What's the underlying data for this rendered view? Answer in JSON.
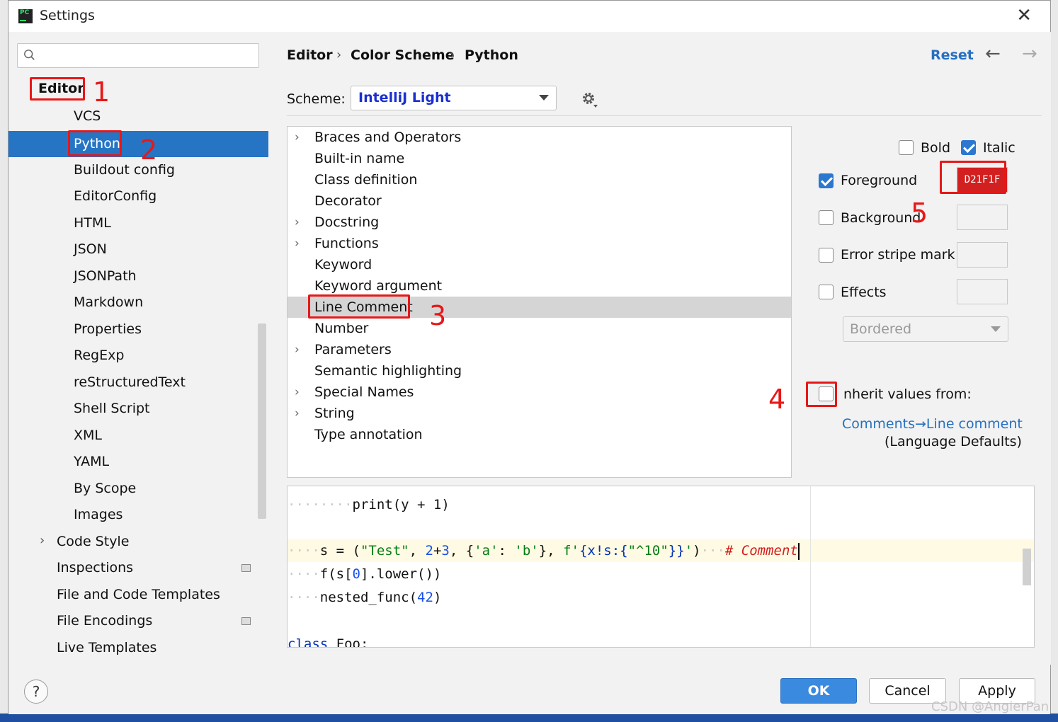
{
  "window": {
    "title": "Settings"
  },
  "sidebar": {
    "search_placeholder": "",
    "items": [
      {
        "label": "Editor"
      },
      {
        "label": "VCS"
      },
      {
        "label": "Python"
      },
      {
        "label": "Buildout config"
      },
      {
        "label": "EditorConfig"
      },
      {
        "label": "HTML"
      },
      {
        "label": "JSON"
      },
      {
        "label": "JSONPath"
      },
      {
        "label": "Markdown"
      },
      {
        "label": "Properties"
      },
      {
        "label": "RegExp"
      },
      {
        "label": "reStructuredText"
      },
      {
        "label": "Shell Script"
      },
      {
        "label": "XML"
      },
      {
        "label": "YAML"
      },
      {
        "label": "By Scope"
      },
      {
        "label": "Images"
      },
      {
        "label": "Code Style"
      },
      {
        "label": "Inspections"
      },
      {
        "label": "File and Code Templates"
      },
      {
        "label": "File Encodings"
      },
      {
        "label": "Live Templates"
      }
    ]
  },
  "breadcrumb": {
    "items": [
      "Editor",
      "Color Scheme",
      "Python"
    ]
  },
  "header": {
    "reset": "Reset"
  },
  "scheme": {
    "label": "Scheme:",
    "value": "IntelliJ Light"
  },
  "attributes": {
    "items": [
      {
        "label": "Braces and Operators"
      },
      {
        "label": "Built-in name"
      },
      {
        "label": "Class definition"
      },
      {
        "label": "Decorator"
      },
      {
        "label": "Docstring"
      },
      {
        "label": "Functions"
      },
      {
        "label": "Keyword"
      },
      {
        "label": "Keyword argument"
      },
      {
        "label": "Line Comment"
      },
      {
        "label": "Number"
      },
      {
        "label": "Parameters"
      },
      {
        "label": "Semantic highlighting"
      },
      {
        "label": "Special Names"
      },
      {
        "label": "String"
      },
      {
        "label": "Type annotation"
      }
    ]
  },
  "properties": {
    "bold": "Bold",
    "italic": "Italic",
    "foreground": "Foreground",
    "foreground_color": "D21F1F",
    "background": "Background",
    "error_stripe": "Error stripe mark",
    "effects": "Effects",
    "effects_type": "Bordered",
    "inherit": "nherit values from:",
    "inherit_link": "Comments→Line comment",
    "inherit_note": "(Language Defaults)"
  },
  "annotations": [
    "1",
    "2",
    "3",
    "4",
    "5"
  ],
  "preview": {
    "line1_code": "print(y + 1)",
    "line2_var": "s = (",
    "line2_str1": "\"Test\"",
    "line2_n1": "2",
    "line2_plus": "+",
    "line2_n2": "3",
    "line2_dict_open": ", {",
    "line2_str2": "'a'",
    "line2_colon": ": ",
    "line2_str3": "'b'",
    "line2_dict_close": "}, ",
    "line2_fstr1": "f'",
    "line2_fexpr": "{x!s:{",
    "line2_fstr2": "\"^10\"",
    "line2_fclose": "}}",
    "line2_fstr3": "'",
    "line2_end": ")",
    "line2_comment": "# Comment",
    "line3_a": "f(s[",
    "line3_n": "0",
    "line3_b": "].lower())",
    "line4_a": "nested_func(",
    "line4_n": "42",
    "line4_b": ")",
    "line5_kw": "class",
    "line5_rest": " Foo:"
  },
  "buttons": {
    "ok": "OK",
    "cancel": "Cancel",
    "apply": "Apply",
    "help": "?"
  },
  "watermark": "CSDN @AngierPan"
}
